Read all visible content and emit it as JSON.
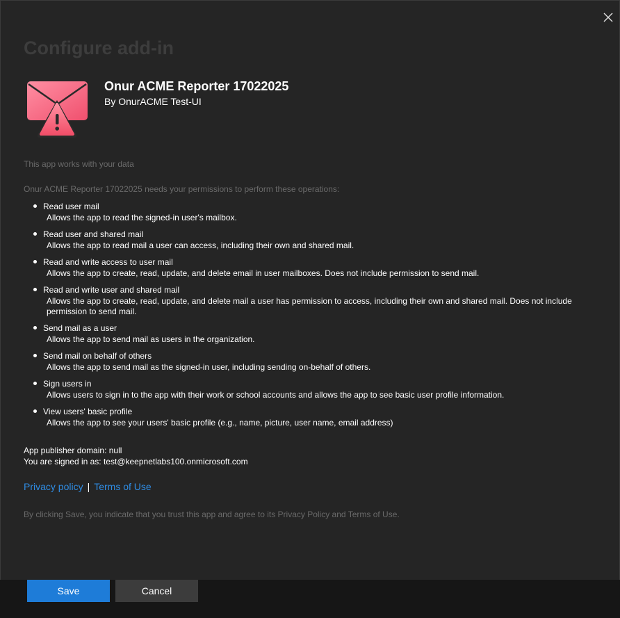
{
  "dialog": {
    "title": "Configure add-in",
    "close_icon": "close-icon"
  },
  "app": {
    "icon": "mail-warning-icon",
    "name": "Onur ACME Reporter 17022025",
    "publisher": "By OnurACME Test-UI"
  },
  "notes": {
    "data_note": "This app works with your data",
    "permissions_intro": "Onur ACME Reporter 17022025 needs your permissions to perform these operations:"
  },
  "permissions": [
    {
      "title": "Read user mail",
      "description": "Allows the app to read the signed-in user's mailbox."
    },
    {
      "title": "Read user and shared mail",
      "description": "Allows the app to read mail a user can access, including their own and shared mail."
    },
    {
      "title": "Read and write access to user mail",
      "description": "Allows the app to create, read, update, and delete email in user mailboxes. Does not include permission to send mail."
    },
    {
      "title": "Read and write user and shared mail",
      "description": "Allows the app to create, read, update, and delete mail a user has permission to access, including their own and shared mail. Does not include permission to send mail."
    },
    {
      "title": "Send mail as a user",
      "description": "Allows the app to send mail as users in the organization."
    },
    {
      "title": "Send mail on behalf of others",
      "description": "Allows the app to send mail as the signed-in user, including sending on-behalf of others."
    },
    {
      "title": "Sign users in",
      "description": "Allows users to sign in to the app with their work or school accounts and allows the app to see basic user profile information."
    },
    {
      "title": "View users' basic profile",
      "description": "Allows the app to see your users' basic profile (e.g., name, picture, user name, email address)"
    }
  ],
  "account": {
    "publisher_domain": "App publisher domain: null",
    "signed_in_as": "You are signed in as: test@keepnetlabs100.onmicrosoft.com"
  },
  "links": {
    "privacy": "Privacy policy",
    "separator": "|",
    "terms": "Terms of Use"
  },
  "consent_note": "By clicking Save, you indicate that you trust this app and agree to its Privacy Policy and Terms of Use.",
  "buttons": {
    "save": "Save",
    "cancel": "Cancel"
  },
  "colors": {
    "background": "#252525",
    "link": "#2f8ce3",
    "primary_button": "#1e7cd8",
    "secondary_button": "#3c3c3c",
    "icon_pink": "#ff6f91"
  }
}
